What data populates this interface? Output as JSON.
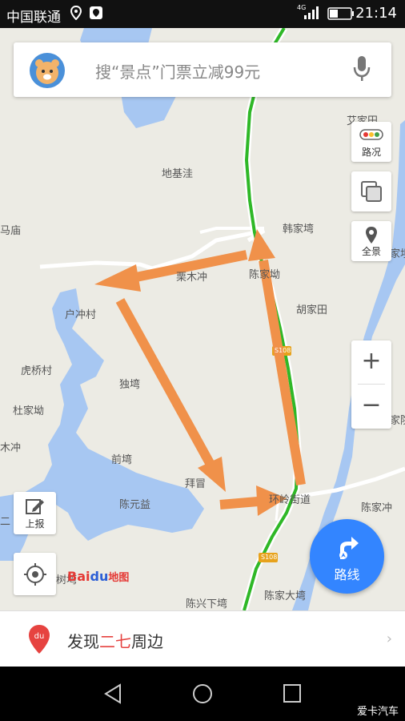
{
  "status_bar": {
    "carrier": "中国联通",
    "time": "21:14",
    "network": "4G"
  },
  "search": {
    "placeholder": "搜“景点”门票立减99元"
  },
  "side_buttons": {
    "traffic": "路况",
    "layers": "",
    "panorama": "全景"
  },
  "left_buttons": {
    "report": "上报"
  },
  "route_button": {
    "label": "路线"
  },
  "map_labels": {
    "dijiwa": "地基洼",
    "mamiao": "马庙",
    "hanjiawan": "韩家塆",
    "limuchong": "栗木冲",
    "chenjiaao": "陈家坳",
    "huchongcun": "户冲村",
    "hujiatian": "胡家田",
    "huqiaocun": "虎桥村",
    "duwan": "独塆",
    "dujiaao": "杜家坳",
    "muchong": "木冲",
    "qianwan": "前塆",
    "baiwan": "拜冒",
    "chenyuanyi": "陈元益",
    "lingjiedao": "环岭街道",
    "chenjiachong": "陈家冲",
    "chenxingxiawan": "陈兴下塆",
    "chenjiadawan": "陈家大塆",
    "aijiatian": "艾家田",
    "jiayuan": "家坝",
    "jiaxian": "家院",
    "road_s108_a": "S108",
    "road_s108_b": "S108",
    "cuiwan": "树塆",
    "ermiao": "二"
  },
  "logo": {
    "text_bai": "Bai",
    "text_du": "du",
    "text_map": "地图"
  },
  "bottom": {
    "prefix": "发现",
    "highlight": "二七",
    "suffix": "周边"
  },
  "watermark": "爱卡汽车",
  "colors": {
    "accent": "#3385ff",
    "arrow": "#f0914a",
    "water": "#a7c7f2",
    "road_green": "#2fb827"
  }
}
